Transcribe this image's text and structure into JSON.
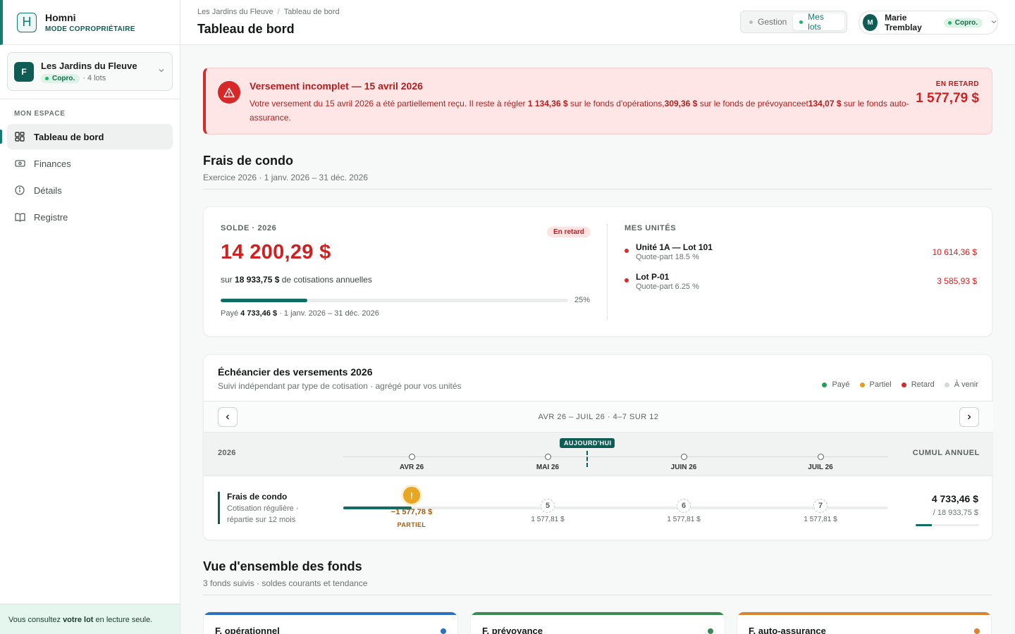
{
  "brand": {
    "name": "Homni",
    "mode": "MODE COPROPRIÉTAIRE",
    "logo_letter": "H"
  },
  "lot_selector": {
    "avatar": "F",
    "name": "Les Jardins du Fleuve",
    "badge": "Copro.",
    "lots": "· 4 lots"
  },
  "sidebar": {
    "section": "MON ESPACE",
    "items": [
      {
        "label": "Tableau de bord",
        "icon": "dashboard-icon",
        "active": true
      },
      {
        "label": "Finances",
        "icon": "money-icon"
      },
      {
        "label": "Détails",
        "icon": "info-icon"
      },
      {
        "label": "Registre",
        "icon": "book-icon"
      }
    ],
    "readonly_prefix": "Vous consultez ",
    "readonly_bold": "votre lot",
    "readonly_suffix": " en lecture seule."
  },
  "header": {
    "breadcrumb": [
      "Les Jardins du Fleuve",
      "Tableau de bord"
    ],
    "breadcrumb_sep": "/",
    "title": "Tableau de bord",
    "toggle": [
      {
        "label": "Gestion",
        "active": false
      },
      {
        "label": "Mes lots",
        "active": true
      }
    ],
    "user": {
      "initial": "M",
      "name": "Marie Tremblay",
      "badge": "Copro."
    }
  },
  "alert": {
    "title": "Versement incomplet — 15 avril 2026",
    "text_1": "Votre versement du 15 avril 2026 a été partiellement reçu. Il reste à régler ",
    "amount_ops": "1 134,36 $",
    "text_2": " sur le fonds d'opérations,",
    "amount_prev": "309,36 $",
    "text_3": " sur le fonds de prévoyanceet",
    "amount_auto": "134,07 $",
    "text_4": " sur le fonds auto-assurance.",
    "status": "EN RETARD",
    "amount": "1 577,79 $",
    "colors": {
      "accent": "#d52b2b",
      "background": "#fde6e5"
    }
  },
  "frais": {
    "title": "Frais de condo",
    "subtitle": "Exercice 2026 · 1 janv. 2026 – 31 déc. 2026"
  },
  "solde": {
    "label": "SOLDE · 2026",
    "badge": "En retard",
    "amount": "14 200,29 $",
    "sur_prefix": "sur ",
    "sur_amount": "18 933,75 $",
    "sur_suffix": " de cotisations annuelles",
    "progress_pct": 25,
    "progress_label": "25%",
    "paid_prefix": "Payé ",
    "paid_amount": "4 733,46 $",
    "paid_suffix": " · 1 janv. 2026 – 31 déc. 2026"
  },
  "units": {
    "label": "MES UNITÉS",
    "items": [
      {
        "name": "Unité 1A — Lot 101",
        "quote": "Quote-part 18.5 %",
        "amount": "10 614,36 $"
      },
      {
        "name": "Lot P-01",
        "quote": "Quote-part 6.25 %",
        "amount": "3 585,93 $"
      }
    ]
  },
  "schedule": {
    "title": "Échéancier des versements 2026",
    "subtitle": "Suivi indépendant par type de cotisation · agrégé pour vos unités",
    "legend": [
      {
        "label": "Payé",
        "color": "#22a05a"
      },
      {
        "label": "Partiel",
        "color": "#e0a024"
      },
      {
        "label": "Retard",
        "color": "#d52b2b"
      },
      {
        "label": "À venir",
        "color": "#d4d8d7"
      }
    ],
    "range": "AVR 26 – JUIL 26 · 4–7 SUR 12",
    "year": "2026",
    "cumul_label": "CUMUL ANNUEL",
    "today_label": "AUJOURD'HUI",
    "months": [
      "AVR 26",
      "MAI 26",
      "JUIN 26",
      "JUIL 26"
    ],
    "row": {
      "title": "Frais de condo",
      "subtitle": "Cotisation régulière · répartie sur 12 mois",
      "marks": [
        {
          "symbol": "!",
          "amount": "−1 577,78 $",
          "status": "PARTIEL",
          "state": "partial"
        },
        {
          "symbol": "5",
          "amount": "1 577,81 $",
          "state": "upcoming"
        },
        {
          "symbol": "6",
          "amount": "1 577,81 $",
          "state": "upcoming"
        },
        {
          "symbol": "7",
          "amount": "1 577,81 $",
          "state": "upcoming"
        }
      ],
      "cumul_amount": "4 733,46 $",
      "cumul_of": "/ 18 933,75 $",
      "cumul_pct": 25
    }
  },
  "funds": {
    "title": "Vue d'ensemble des fonds",
    "subtitle": "3 fonds suivis · soldes courants et tendance",
    "items": [
      {
        "name": "F. opérationnel",
        "color": "#2f6fbf"
      },
      {
        "name": "F. prévoyance",
        "color": "#3a8a52"
      },
      {
        "name": "F. auto-assurance",
        "color": "#d98230"
      }
    ]
  }
}
